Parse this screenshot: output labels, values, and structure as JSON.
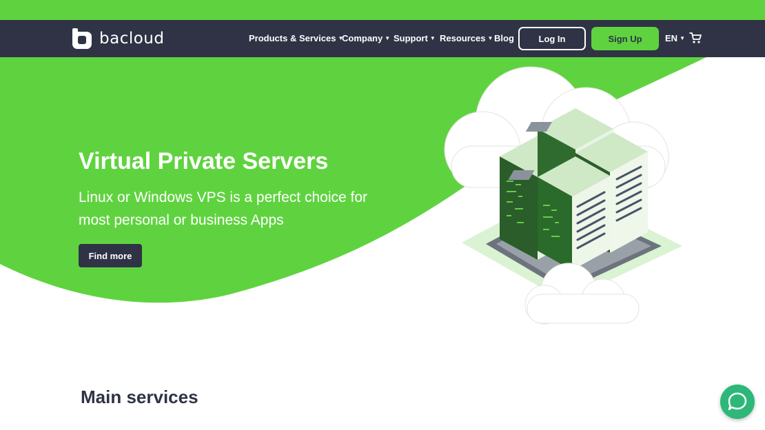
{
  "brand": {
    "name": "bacloud",
    "logo_icon": "b-logo-icon"
  },
  "nav": {
    "items": [
      {
        "label": "Products & Services",
        "dropdown": true
      },
      {
        "label": "Company",
        "dropdown": true
      },
      {
        "label": "Support",
        "dropdown": true
      },
      {
        "label": "Resources",
        "dropdown": true
      },
      {
        "label": "Blog",
        "dropdown": false
      }
    ],
    "login_label": "Log In",
    "signup_label": "Sign Up",
    "language": "EN",
    "cart_icon": "cart-icon"
  },
  "hero": {
    "title": "Virtual Private Servers",
    "subtitle": "Linux or Windows VPS is a perfect choice for most personal or business Apps",
    "cta_label": "Find more",
    "illustration": "server-rack-cloud-illustration"
  },
  "main": {
    "section_title": "Main services"
  },
  "chat_widget": {
    "icon": "chat-bubble-icon"
  },
  "colors": {
    "accent_green": "#5fd33f",
    "navbar_dark": "#2f3345",
    "chat_green": "#2db87a"
  }
}
